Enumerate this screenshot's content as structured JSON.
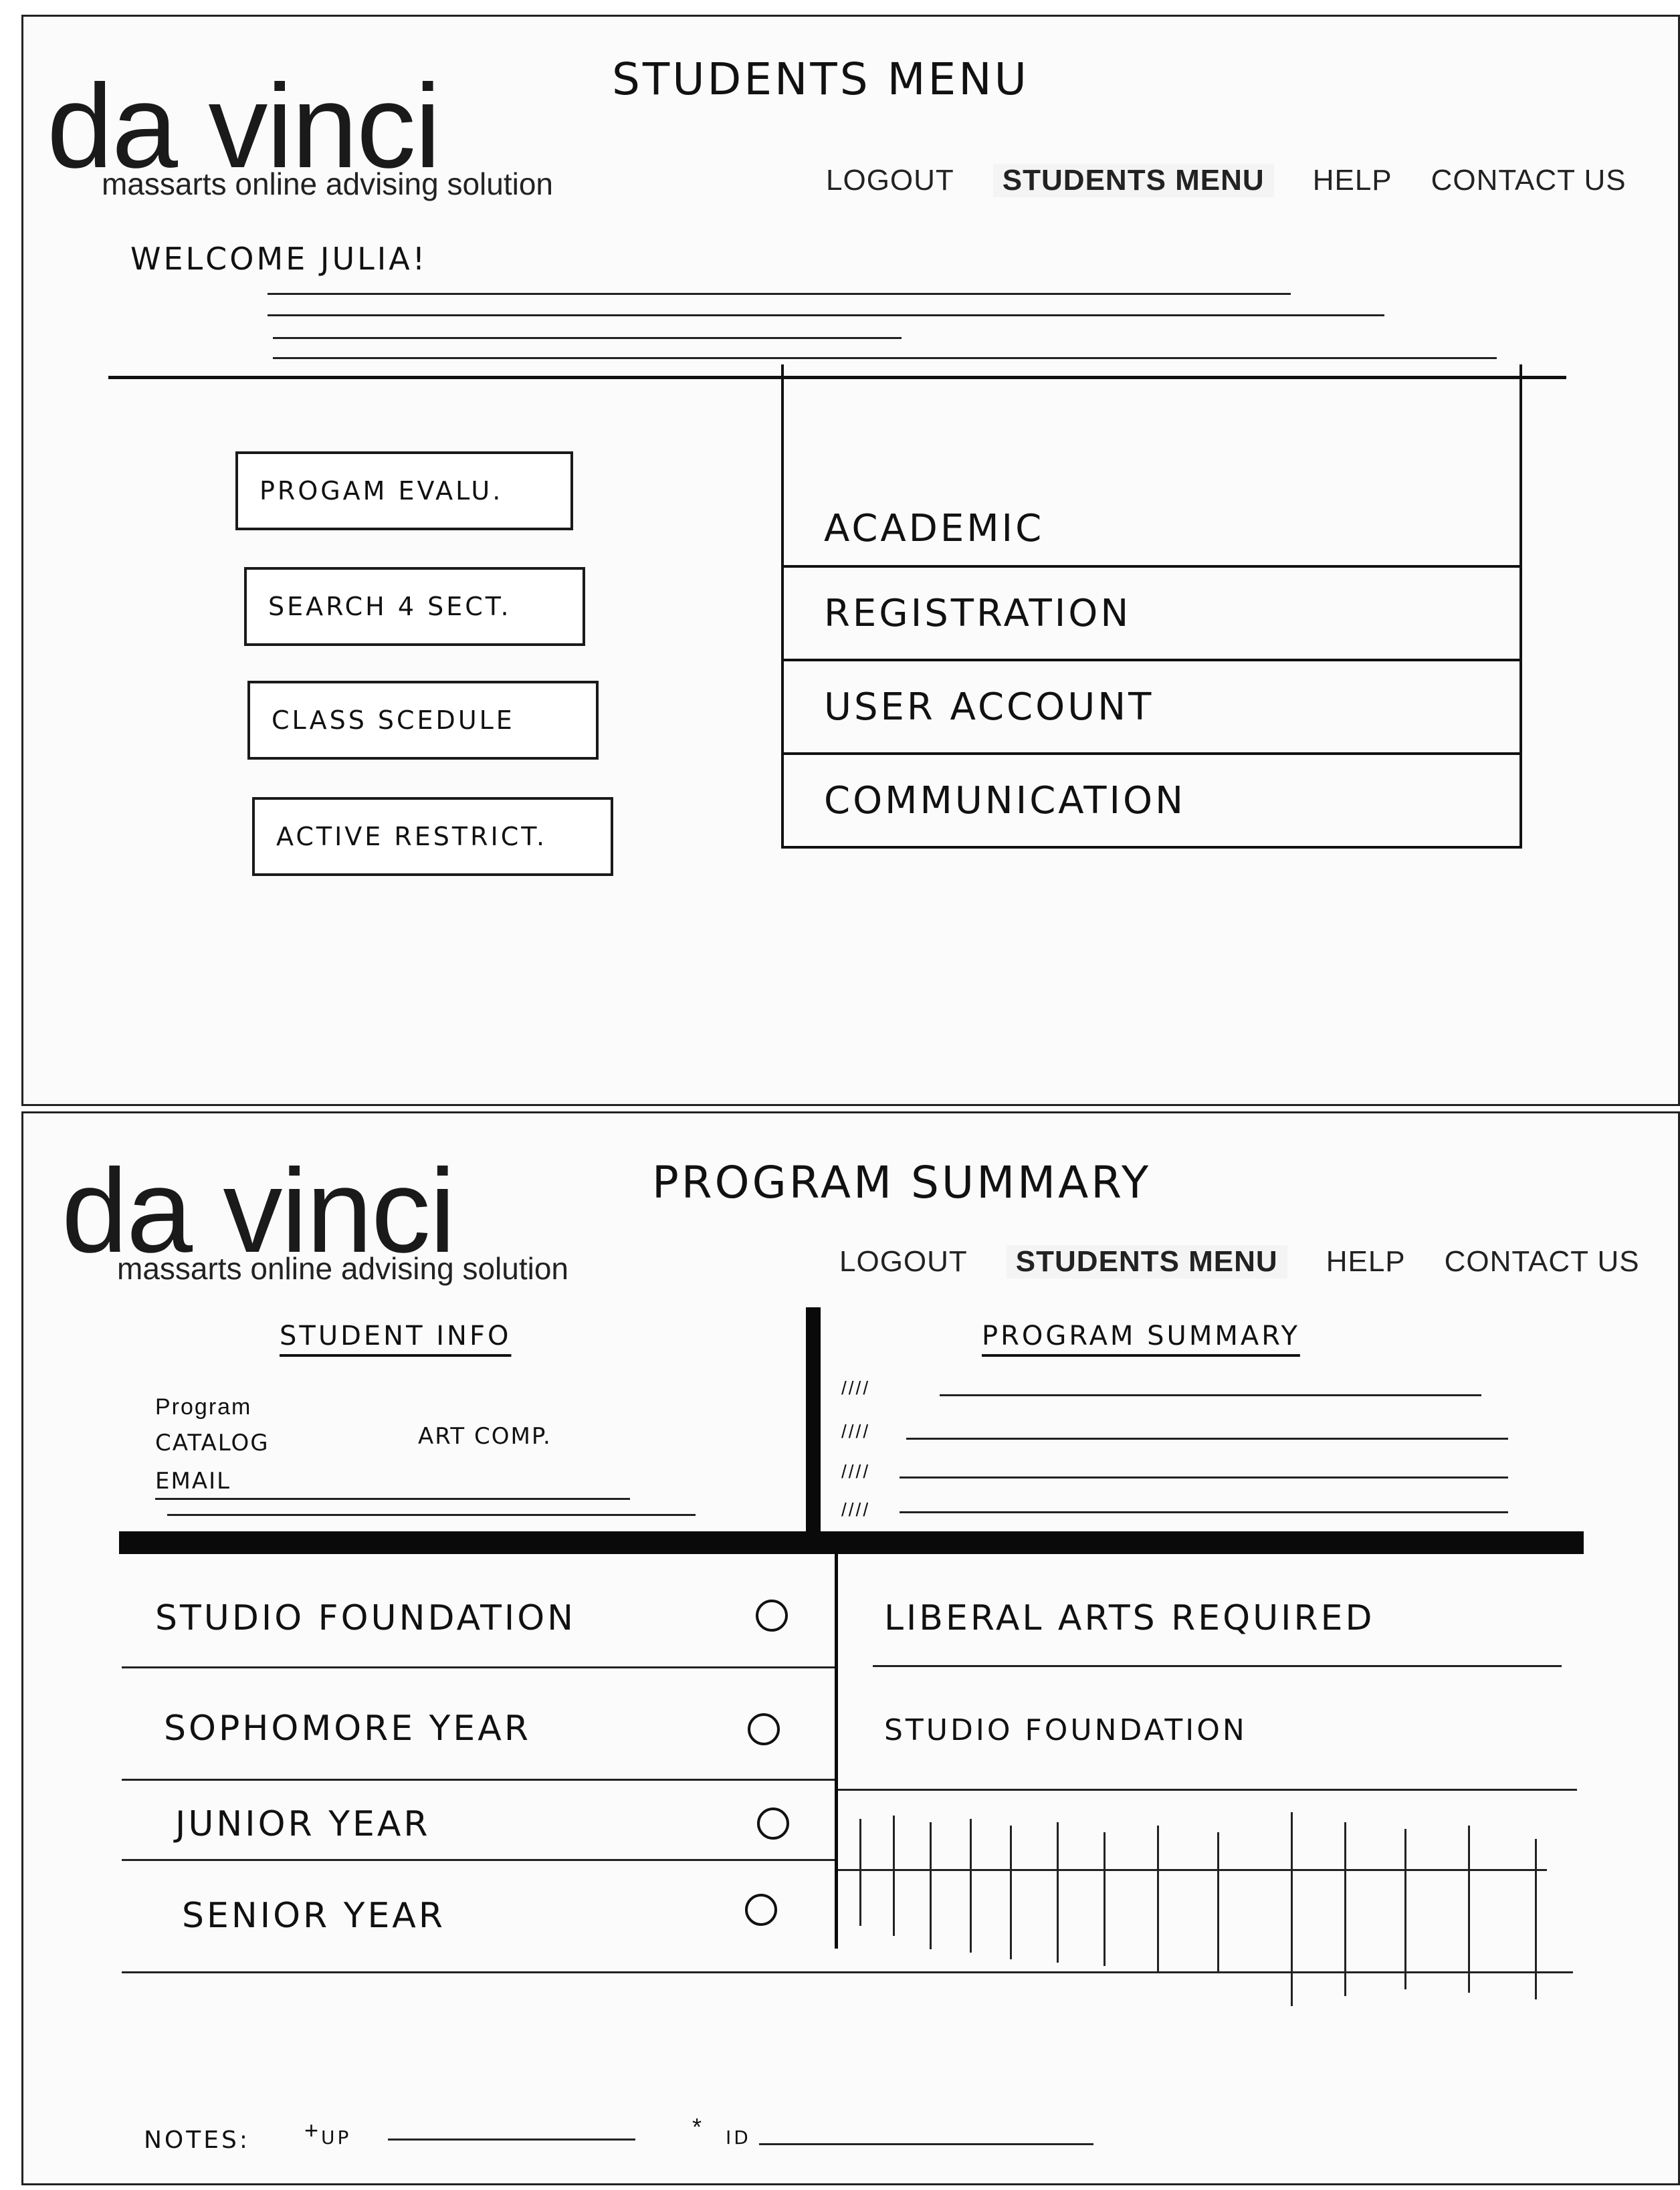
{
  "screen1": {
    "logo": "da vinci",
    "tagline": "massarts online advising solution",
    "page_title": "STUDENTS MENU",
    "nav": [
      "LOGOUT",
      "STUDENTS MENU",
      "HELP",
      "CONTACT US"
    ],
    "welcome": "WELCOME   JULIA!",
    "buttons": [
      "PROGAM EVALU.",
      "SEARCH 4 SECT.",
      "CLASS SCEDULE",
      "ACTIVE RESTRICT."
    ],
    "tabs": [
      "ACADEMIC",
      "REGISTRATION",
      "USER ACCOUNT",
      "COMMUNICATION"
    ]
  },
  "screen2": {
    "logo": "da vinci",
    "tagline": "massarts online advising solution",
    "page_title": "PROGRAM SUMMARY",
    "nav": [
      "LOGOUT",
      "STUDENTS MENU",
      "HELP",
      "CONTACT US"
    ],
    "student_info_heading": "STUDENT INFO",
    "program_summary_heading": "PROGRAM SUMMARY",
    "info_labels": [
      "Program",
      "CATALOG",
      "EMAIL"
    ],
    "info_value": "ART COMP.",
    "summary_ticks": [
      "////",
      "////",
      "////",
      "////"
    ],
    "years": [
      "STUDIO FOUNDATION",
      "SOPHOMORE YEAR",
      "JUNIOR YEAR",
      "SENIOR YEAR"
    ],
    "requirements": [
      "LIBERAL ARTS REQUIRED",
      "STUDIO FOUNDATION"
    ],
    "notes_label": "NOTES:",
    "notes_marks": [
      "+",
      "*"
    ],
    "notes_fields": [
      "UP",
      "ID"
    ]
  }
}
